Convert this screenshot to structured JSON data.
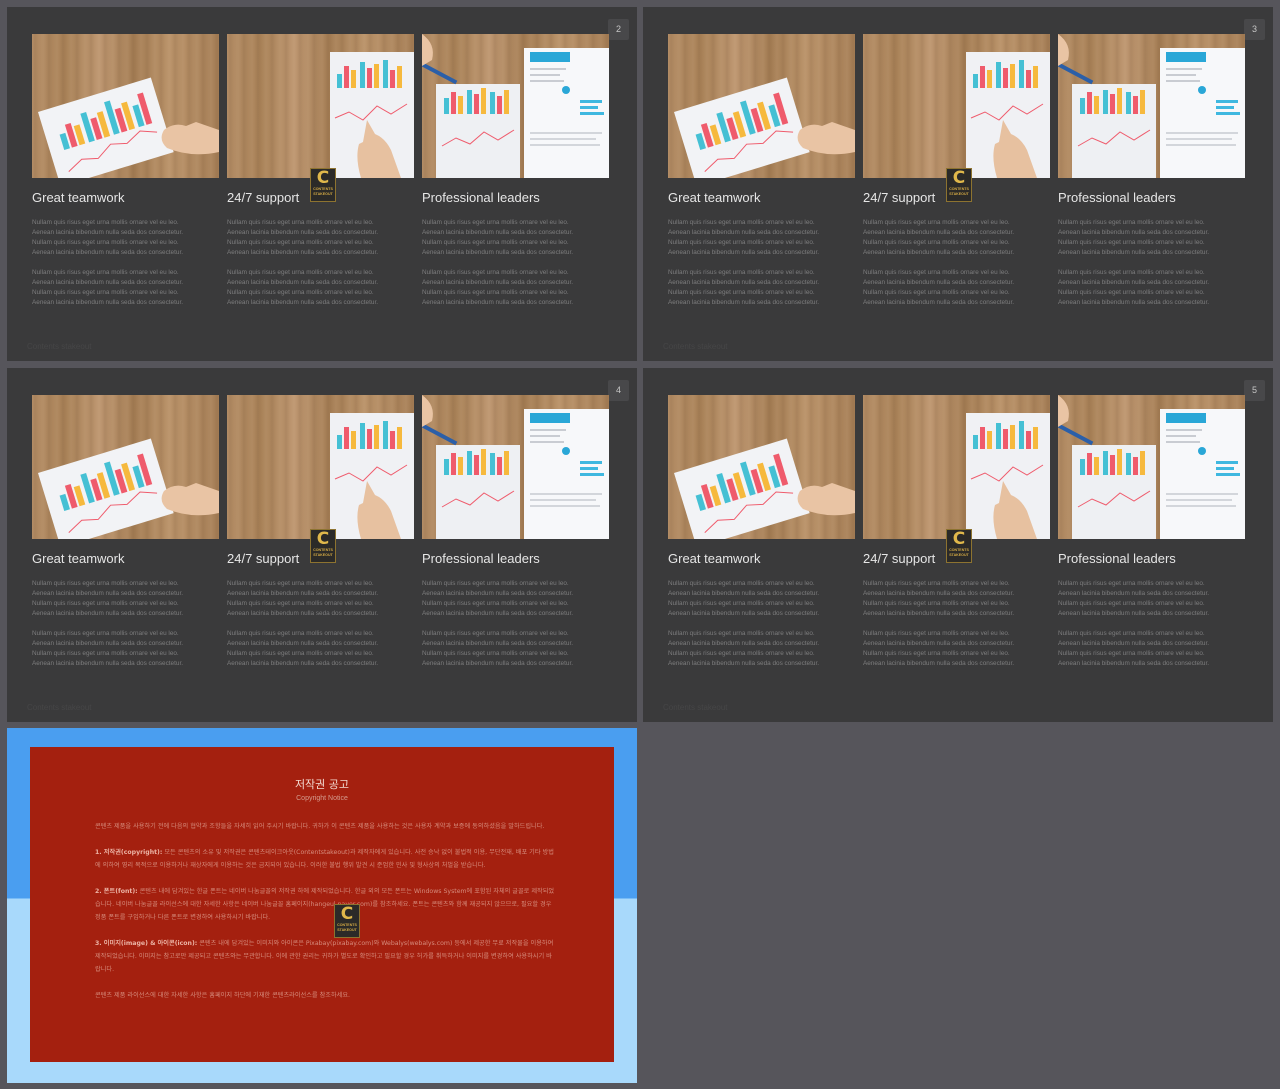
{
  "slides": [
    {
      "number": "2"
    },
    {
      "number": "3"
    },
    {
      "number": "4"
    },
    {
      "number": "5"
    }
  ],
  "slide_footer": "Contents stakeout",
  "columns": [
    {
      "title": "Great teamwork",
      "photo": "bar-chart-paper-with-fist"
    },
    {
      "title": "24/7 support",
      "photo": "chart-paper-finger-pointing"
    },
    {
      "title": "Professional leaders",
      "photo": "report-pages-with-pen"
    }
  ],
  "body_lines": [
    "Nullam quis risus eget urna mollis ornare vel eu leo.",
    "Aenean lacinia bibendum nulla seda dos consectetur.",
    "Nullam quis risus eget urna mollis ornare vel eu leo.",
    "Aenean lacinia bibendum nulla seda dos consectetur."
  ],
  "watermark": {
    "letter": "C",
    "line1": "CONTENTS",
    "line2": "STAKEOUT"
  },
  "copyright": {
    "title": "저작권 공고",
    "subtitle": "Copyright Notice",
    "intro": "콘텐츠 제품을 사용하기 전에 다음의 협약과 조항들을 자세히 읽어 주시기 바랍니다. 귀하가 이 콘텐츠 제품을 사용하는 것은 사용자 계약과 보증에 동의하셨음을 말하드립니다.",
    "s1_head": "1. 저작권(copyright):",
    "s1_text": "모든 콘텐츠의 소유 및 저작권은 콘텐츠테이크아웃(Contentstakeout)과 제작자에게 있습니다. 사전 승낙 없이 불법적 이용, 무단전재, 배포 기타 방법에 의하여 영리 목적으로 이용하거나 재상자에게 이용하는 것은 금지되어 있습니다. 이러한 불법 행위 발견 시 준엄한 민사 및 형사상의 처벌을 받습니다.",
    "s2_head": "2. 폰트(font):",
    "s2_text": "콘텐츠 내에 담겨있는 한글 폰트는 네이버 나눔글꼴의 저작권 하에 제작되었습니다. 한글 외의 모든 폰트는 Windows System에 포함된 자체의 글꼴로 제작되었습니다. 네이버 나눔글꼴 라이선스에 대한 자세한 사항은 네이버 나눔글꼴 홈페이지(hangeul.naver.com)를 참조하세요. 폰트는 콘텐츠와 함께 재공되지 않으므로, 필요할 경우 정품 폰트를 구입하거나 다른 폰트로 변경하여 사용하시기 바랍니다.",
    "s3_head": "3. 이미지(image) & 아이콘(icon):",
    "s3_text": "콘텐츠 내에 담겨있는 이미지와 아이콘은 Pixabay(pixabay.com)와 Webalys(webalys.com) 등에서 제공한 무료 저작물을 이용하여 제작되었습니다. 이미지는 참고로만 제공되고 콘텐츠와는 무관합니다. 이에 관한 권리는 귀하가 별도로 확인하고 필요할 경우 허가를 취득하거나 이미지를 변경하여 사용하시기 바랍니다.",
    "outro": "콘텐츠 제품 라이선스에 대한 자세한 사항은 홈페이지 하단에 기재한 콘텐츠라이선스를 참조하세요."
  }
}
